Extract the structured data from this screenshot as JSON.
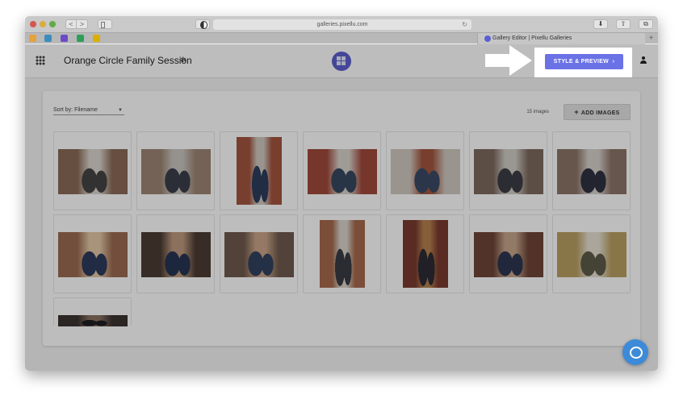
{
  "browser": {
    "url": "galleries.pixellu.com",
    "tab_title": "Gallery Editor | Pixellu Galleries",
    "back_label": "<",
    "forward_label": ">",
    "new_tab_label": "+",
    "bookmark_colors": [
      "#e6a23c",
      "#3c8dbc",
      "#6b4bc8",
      "#2e9e5b",
      "#d9b000"
    ]
  },
  "header": {
    "gallery_title": "Orange Circle Family Session",
    "style_preview_label": "STYLE & PREVIEW",
    "style_preview_chevron": "›",
    "brand_color": "#5b5fcf",
    "accent_color": "#6b72e6"
  },
  "toolbar": {
    "sort_label": "Sort by: Filename",
    "image_count": "15 images",
    "add_images_label": "ADD IMAGES",
    "add_icon": "+"
  },
  "thumbnails": [
    {
      "orientation": "land",
      "colors": [
        "#8a6a58",
        "#d9d4cd",
        "#444"
      ]
    },
    {
      "orientation": "land",
      "colors": [
        "#9c8573",
        "#c9c5c0",
        "#3a3f4b"
      ]
    },
    {
      "orientation": "port",
      "colors": [
        "#a2543f",
        "#cfc9c0",
        "#2d3c5e"
      ]
    },
    {
      "orientation": "land",
      "colors": [
        "#a04a3a",
        "#d7d1c9",
        "#374860"
      ]
    },
    {
      "orientation": "land",
      "colors": [
        "#cfc8bf",
        "#a3553e",
        "#3a4a66"
      ]
    },
    {
      "orientation": "land",
      "colors": [
        "#7d6a5e",
        "#d0ccc6",
        "#3b3d46"
      ]
    },
    {
      "orientation": "land",
      "colors": [
        "#8c7467",
        "#d5d1cc",
        "#2f3342"
      ]
    },
    {
      "orientation": "land",
      "colors": [
        "#9a6b52",
        "#e3c8a7",
        "#2d3b5b"
      ]
    },
    {
      "orientation": "land",
      "colors": [
        "#4b3c34",
        "#bd9a7f",
        "#263553"
      ]
    },
    {
      "orientation": "land",
      "colors": [
        "#6f5a4d",
        "#c9a487",
        "#31415f"
      ]
    },
    {
      "orientation": "port",
      "colors": [
        "#a66a4e",
        "#d9d3cb",
        "#3a3a44"
      ]
    },
    {
      "orientation": "port",
      "colors": [
        "#7a3a2e",
        "#b5804f",
        "#2c2c34"
      ]
    },
    {
      "orientation": "land",
      "colors": [
        "#6e4638",
        "#c7a58c",
        "#2e3652"
      ]
    },
    {
      "orientation": "land",
      "colors": [
        "#b99f62",
        "#e6e1d2",
        "#5d5a4a"
      ]
    },
    {
      "orientation": "partial",
      "colors": [
        "#3a3330",
        "#8c7262",
        "#1e1e22"
      ]
    }
  ]
}
